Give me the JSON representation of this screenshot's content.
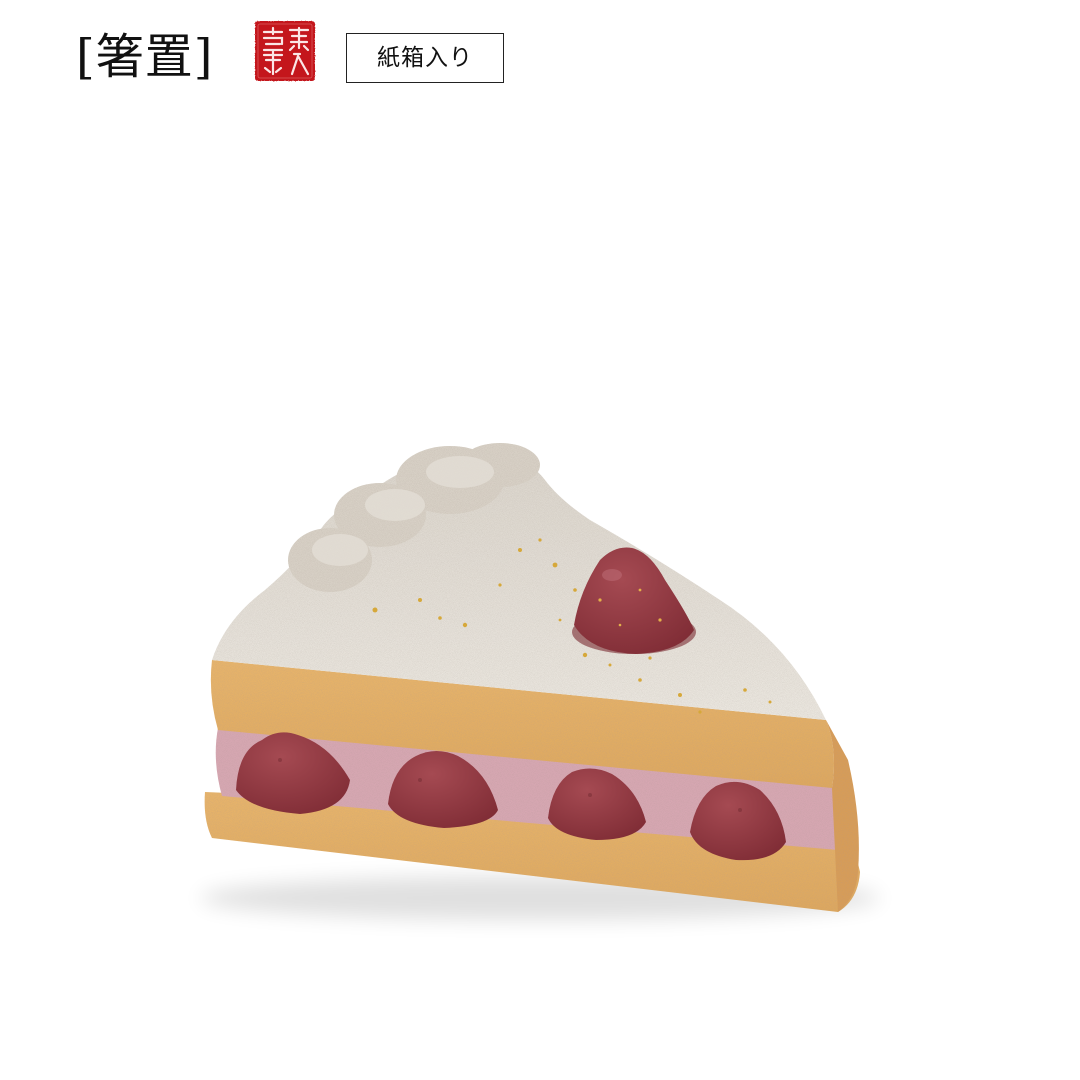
{
  "header": {
    "category_title": "[箸置]",
    "seal": {
      "characters": [
        "樂",
        "入",
        "窯"
      ],
      "color": "#c4161c",
      "icon": "red-kiln-seal"
    },
    "package_badge": "紙箱入り"
  },
  "product": {
    "icon": "strawberry-shortcake-chopstick-rest"
  }
}
